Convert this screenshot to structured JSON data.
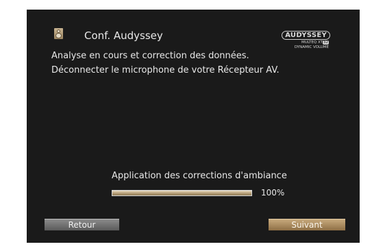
{
  "header": {
    "title": "Conf. Audyssey",
    "icon": "speaker-icon"
  },
  "logo": {
    "brand": "AUDYSSEY",
    "line1_prefix": "MULTEQ XT",
    "line1_badge": "32",
    "line2": "DYNAMIC VOLUME"
  },
  "messages": {
    "line1": "Analyse en cours et correction des données.",
    "line2": "Déconnecter le microphone de votre Récepteur AV."
  },
  "progress": {
    "label": "Application des corrections d'ambiance",
    "value_text": "100%",
    "fraction": 1.0
  },
  "buttons": {
    "back": "Retour",
    "next": "Suivant"
  },
  "colors": {
    "background": "#1a1a1a",
    "accent": "#b9a27a",
    "text": "#e8e8e8"
  }
}
